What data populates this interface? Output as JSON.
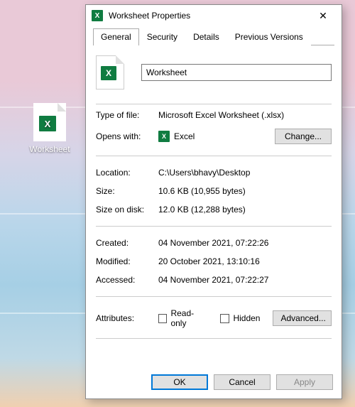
{
  "desktop": {
    "icon_label": "Worksheet"
  },
  "window": {
    "title": "Worksheet Properties",
    "tabs": [
      "General",
      "Security",
      "Details",
      "Previous Versions"
    ],
    "active_tab": 0,
    "filename": "Worksheet",
    "type_of_file_label": "Type of file:",
    "type_of_file": "Microsoft Excel Worksheet (.xlsx)",
    "opens_with_label": "Opens with:",
    "opens_with_app": "Excel",
    "change_btn": "Change...",
    "location_label": "Location:",
    "location": "C:\\Users\\bhavy\\Desktop",
    "size_label": "Size:",
    "size": "10.6 KB (10,955 bytes)",
    "size_on_disk_label": "Size on disk:",
    "size_on_disk": "12.0 KB (12,288 bytes)",
    "created_label": "Created:",
    "created": "04 November 2021, 07:22:26",
    "modified_label": "Modified:",
    "modified": "20 October 2021, 13:10:16",
    "accessed_label": "Accessed:",
    "accessed": "04 November 2021, 07:22:27",
    "attributes_label": "Attributes:",
    "readonly_label": "Read-only",
    "hidden_label": "Hidden",
    "advanced_btn": "Advanced...",
    "ok_btn": "OK",
    "cancel_btn": "Cancel",
    "apply_btn": "Apply"
  }
}
